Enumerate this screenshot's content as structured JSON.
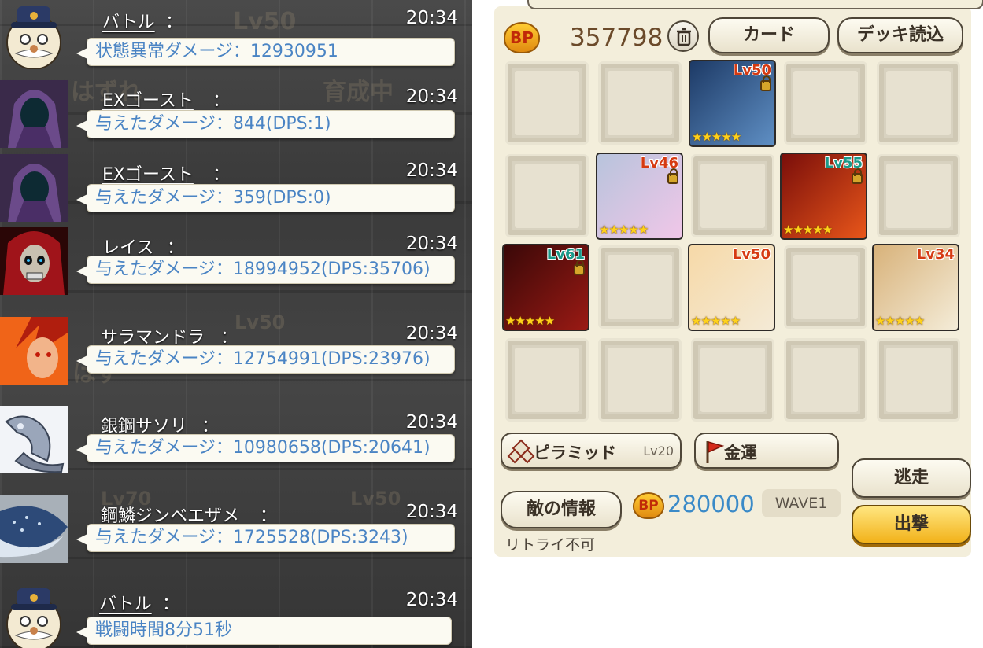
{
  "chat": {
    "messages": [
      {
        "sender": "バトル",
        "time": "20:34",
        "text": "状態異常ダメージ：12930951"
      },
      {
        "sender": "EXゴースト",
        "time": "20:34",
        "text": "与えたダメージ：844(DPS:1)"
      },
      {
        "sender": "EXゴースト",
        "time": "20:34",
        "text": "与えたダメージ：359(DPS:0)"
      },
      {
        "sender": "レイス",
        "time": "20:34",
        "text": "与えたダメージ：18994952(DPS:35706)"
      },
      {
        "sender": "サラマンドラ",
        "time": "20:34",
        "text": "与えたダメージ：12754991(DPS:23976)"
      },
      {
        "sender": "銀鋼サソリ",
        "time": "20:34",
        "text": "与えたダメージ：10980658(DPS:20641)"
      },
      {
        "sender": "鋼鱗ジンベエザメ",
        "time": "20:34",
        "text": "与えたダメージ：1725528(DPS:3243)"
      },
      {
        "sender": "バトル",
        "time": "20:34",
        "text": "戦闘時間8分51秒"
      }
    ],
    "colon": "：",
    "background_text": [
      "Lv50",
      "はずれ",
      "育成中",
      "はず",
      "Lv50",
      "Lv70",
      "Lv50"
    ]
  },
  "deck": {
    "bp_label": "BP",
    "bp_value": "357798",
    "buttons": {
      "card": "カード",
      "deck_load": "デッキ読込",
      "enemy_info": "敵の情報",
      "escape": "逃走",
      "attack": "出撃"
    },
    "cards": [
      {
        "level": "Lv50",
        "stars": "★★★★★",
        "colors": [
          "#1d3a66",
          "#5f8fc4"
        ],
        "level_color": "#d63a12"
      },
      {
        "level": "Lv46",
        "stars": "★★★★★",
        "colors": [
          "#b8c4dc",
          "#f0c6e8"
        ],
        "level_color": "#d63a12"
      },
      {
        "level": "Lv55",
        "stars": "★★★★★",
        "colors": [
          "#7a0e0a",
          "#e8561a"
        ],
        "level_color": "#1a9a8a"
      },
      {
        "level": "Lv61",
        "stars": "★★★★★",
        "colors": [
          "#3a0808",
          "#9a1a14"
        ],
        "level_color": "#1a9a8a"
      },
      {
        "level": "Lv50",
        "stars": "★★★★★",
        "colors": [
          "#f6d9a8",
          "#f4ead6"
        ],
        "level_color": "#d63a12"
      },
      {
        "level": "Lv34",
        "stars": "★★★★★",
        "colors": [
          "#d8b27a",
          "#f4ecd8"
        ],
        "level_color": "#d63a12"
      }
    ],
    "skills": [
      {
        "name": "ピラミッド",
        "level": "Lv20"
      },
      {
        "name": "金運",
        "level": ""
      }
    ],
    "retry_text": "リトライ不可",
    "required_bp": "280000",
    "wave": "WAVE1"
  }
}
